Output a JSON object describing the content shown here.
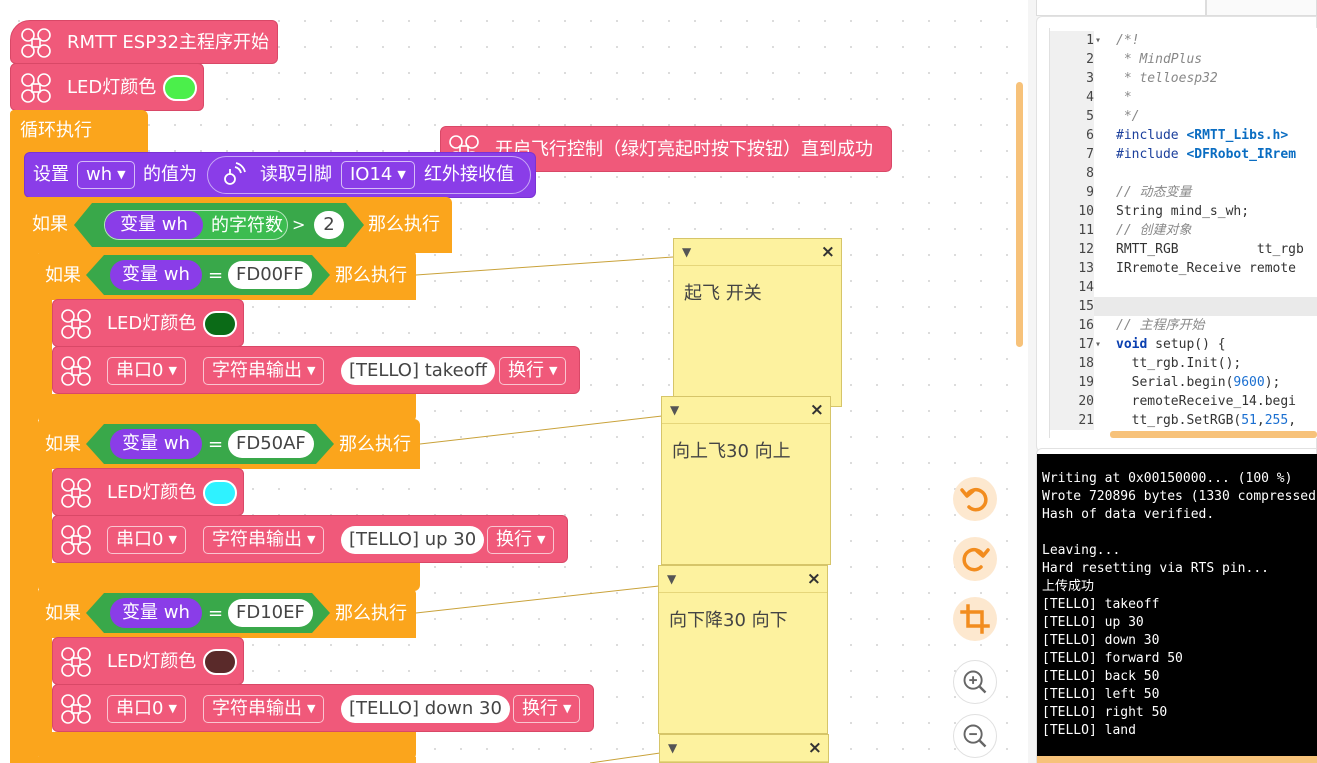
{
  "workspace": {
    "main_block": "RMTT ESP32主程序开始",
    "led_top": {
      "label": "LED灯颜色",
      "color": "#4bef4b"
    },
    "loop_label": "循环执行",
    "floating_block": "开启飞行控制（绿灯亮起时按下按钮）直到成功",
    "set_block": {
      "set_label": "设置",
      "var": "wh",
      "value_label": "的值为",
      "read_label": "读取引脚",
      "pin": "IO14",
      "ir_label": "红外接收值"
    },
    "if_outer": {
      "if_label": "如果",
      "var_label": "变量 wh",
      "len_label": "的字符数",
      "op": ">",
      "num": "2",
      "then_label": "那么执行"
    },
    "cases": [
      {
        "if_label": "如果",
        "var_label": "变量 wh",
        "eq": "=",
        "code": "FD00FF",
        "then_label": "那么执行",
        "led_label": "LED灯颜色",
        "led_color": "#0b6b17",
        "serial": "串口0",
        "out": "字符串输出",
        "text": "[TELLO] takeoff",
        "newline": "换行"
      },
      {
        "if_label": "如果",
        "var_label": "变量 wh",
        "eq": "=",
        "code": "FD50AF",
        "then_label": "那么执行",
        "led_label": "LED灯颜色",
        "led_color": "#2ff2ff",
        "serial": "串口0",
        "out": "字符串输出",
        "text": "[TELLO] up 30",
        "newline": "换行"
      },
      {
        "if_label": "如果",
        "var_label": "变量 wh",
        "eq": "=",
        "code": "FD10EF",
        "then_label": "那么执行",
        "led_label": "LED灯颜色",
        "led_color": "#5a2a2a",
        "serial": "串口0",
        "out": "字符串输出",
        "text": "[TELLO] down 30",
        "newline": "换行"
      }
    ],
    "notes": [
      "起飞 开关",
      "向上飞30  向上",
      "向下降30  向下",
      ""
    ]
  },
  "tools": [
    "undo-icon",
    "redo-icon",
    "crop-icon",
    "zoom-in-icon",
    "zoom-out-icon"
  ],
  "code": {
    "lines": [
      {
        "n": "1",
        "fold": "▾",
        "text": "/*!",
        "cls": "comment"
      },
      {
        "n": "2",
        "fold": "",
        "text": " * MindPlus",
        "cls": "comment"
      },
      {
        "n": "3",
        "fold": "",
        "text": " * telloesp32",
        "cls": "comment"
      },
      {
        "n": "4",
        "fold": "",
        "text": " *",
        "cls": "comment"
      },
      {
        "n": "5",
        "fold": "",
        "text": " */",
        "cls": "comment"
      },
      {
        "n": "6",
        "fold": "",
        "text": "#include <RMTT_Libs.h>",
        "cls": "include"
      },
      {
        "n": "7",
        "fold": "",
        "text": "#include <DFRobot_IRrem",
        "cls": "include"
      },
      {
        "n": "8",
        "fold": "",
        "text": "",
        "cls": "normal"
      },
      {
        "n": "9",
        "fold": "",
        "text": "// 动态变量",
        "cls": "comment"
      },
      {
        "n": "10",
        "fold": "",
        "text": "String mind_s_wh;",
        "cls": "normal"
      },
      {
        "n": "11",
        "fold": "",
        "text": "// 创建对象",
        "cls": "comment"
      },
      {
        "n": "12",
        "fold": "",
        "text": "RMTT_RGB          tt_rgb",
        "cls": "normal"
      },
      {
        "n": "13",
        "fold": "",
        "text": "IRremote_Receive remote",
        "cls": "normal"
      },
      {
        "n": "14",
        "fold": "",
        "text": "",
        "cls": "normal"
      },
      {
        "n": "15",
        "fold": "",
        "text": "",
        "cls": "active"
      },
      {
        "n": "16",
        "fold": "",
        "text": "// 主程序开始",
        "cls": "comment"
      },
      {
        "n": "17",
        "fold": "▾",
        "text": "void setup() {",
        "cls": "void"
      },
      {
        "n": "18",
        "fold": "",
        "text": "  tt_rgb.Init();",
        "cls": "normal"
      },
      {
        "n": "19",
        "fold": "",
        "text": "  Serial.begin(9600);",
        "cls": "num9600"
      },
      {
        "n": "20",
        "fold": "",
        "text": "  remoteReceive_14.begi",
        "cls": "normal"
      },
      {
        "n": "21",
        "fold": "",
        "text": "  tt_rgb.SetRGB(51,255,",
        "cls": "rgb"
      }
    ]
  },
  "terminal": {
    "lines": [
      "Writing at 0x00150000... (100 %)",
      "Wrote 720896 bytes (1330 compressed",
      "Hash of data verified.",
      "",
      "Leaving...",
      "Hard resetting via RTS pin...",
      "上传成功",
      "[TELLO] takeoff",
      "[TELLO] up 30",
      "[TELLO] down 30",
      "[TELLO] forward 50",
      "[TELLO] back 50",
      "[TELLO] left 50",
      "[TELLO] right 50",
      "[TELLO] land"
    ]
  }
}
